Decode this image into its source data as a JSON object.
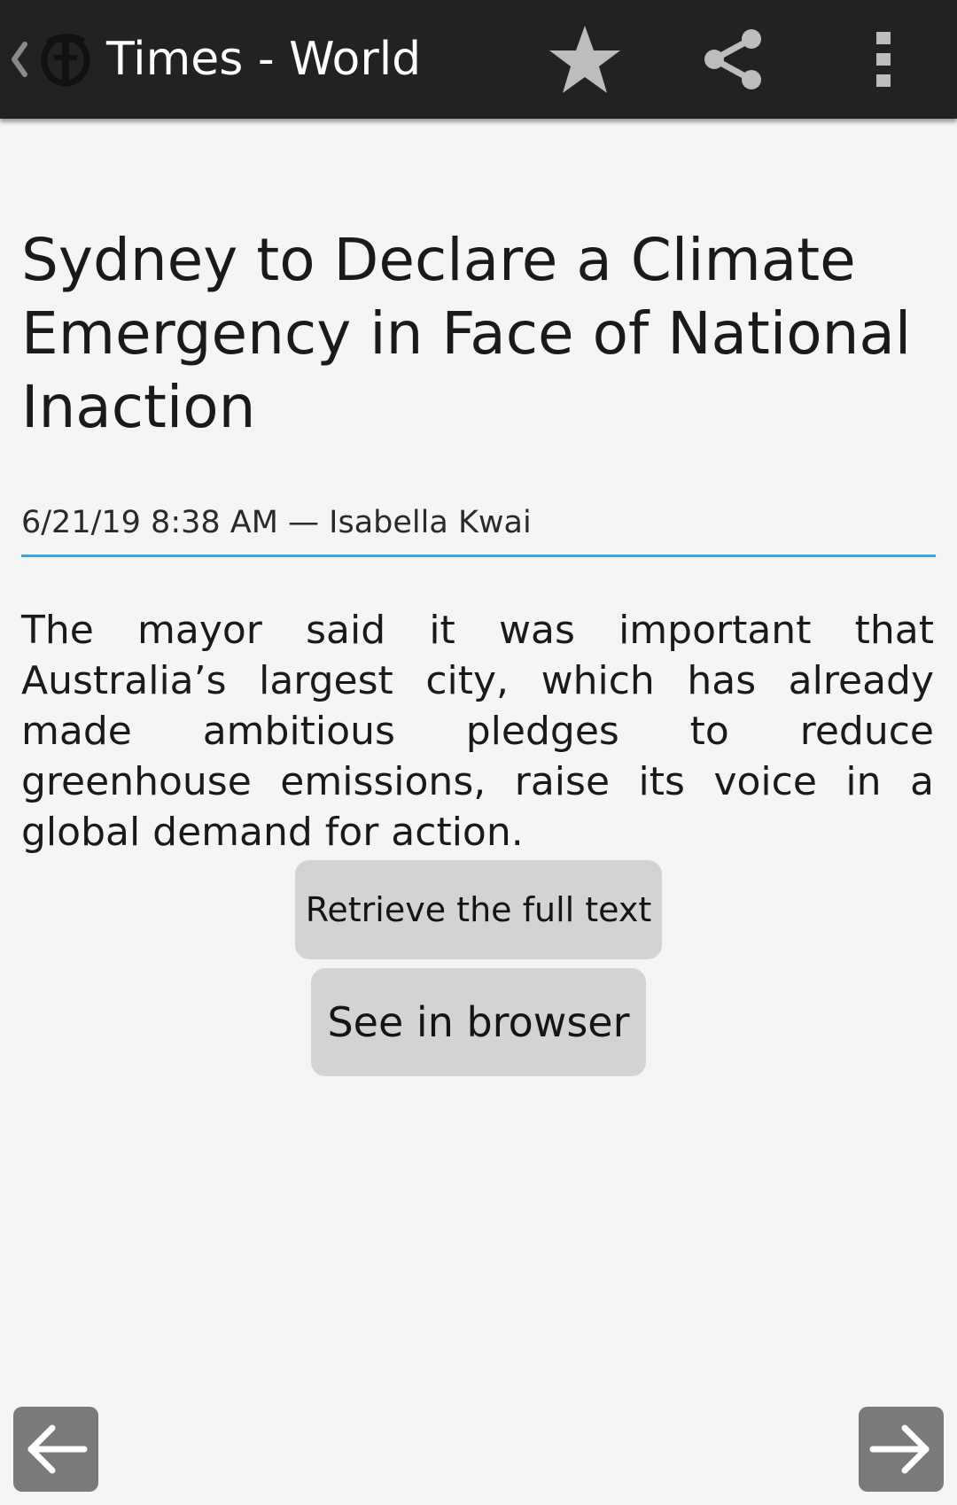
{
  "action_bar": {
    "title": "Times - World",
    "icons": {
      "up": "chevron-left-icon",
      "logo": "nyt-t-logo-icon",
      "favorite": "star-icon",
      "share": "share-icon",
      "overflow": "more-vert-icon"
    },
    "background": "#222222"
  },
  "article": {
    "headline": "Sydney to Declare a Climate Emergency in Face of National Inaction",
    "meta": "6/21/19 8:38 AM — Isabella Kwai",
    "summary": "The mayor said it was important that Australia’s largest city, which has already made ambitious pledges to reduce greenhouse emissions, raise its voice in a global demand for action.",
    "divider_color": "#3aa9e0"
  },
  "buttons": {
    "retrieve_full_text": "Retrieve the full text",
    "see_in_browser": "See in browser"
  },
  "navigation": {
    "previous_icon": "arrow-left-icon",
    "next_icon": "arrow-right-icon"
  }
}
